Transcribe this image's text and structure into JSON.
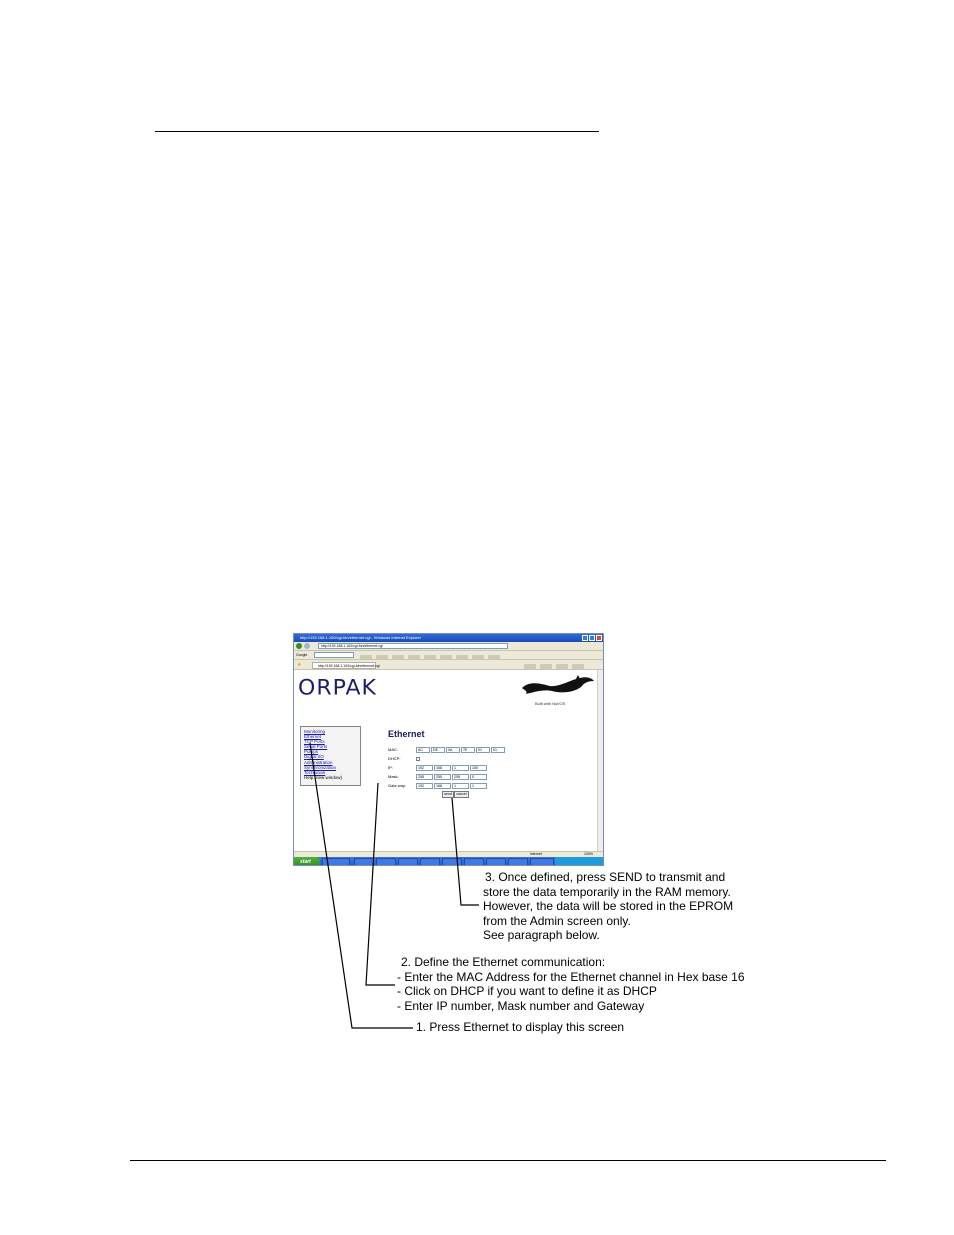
{
  "browser": {
    "title": "http://192.168.1.100/cgi-bin/ethernet.cgi - Windows Internet Explorer",
    "address": "http://192.168.1.100/cgi-bin/ethernet.cgi",
    "google_label": "Google",
    "tab_label": "http://192.168.1.100/cgi-bin/ethernet.cgi",
    "status": "Internet",
    "zoom": "100%",
    "start_label": "start"
  },
  "page": {
    "logo": "ORPAK",
    "built_with": "Built with Nut/OS",
    "heading": "Ethernet",
    "menu": [
      "Monitoring",
      "Ethernet",
      "TCP Ports",
      "Serial Ports",
      "Pumps",
      "Digital I/O",
      "Administration",
      "Synchronization",
      "Technician"
    ],
    "menu_tail": "Help (new window)",
    "form": {
      "mac_label": "MAC:",
      "mac": [
        "AC",
        "DE",
        "0A",
        "7E",
        "01",
        "01"
      ],
      "dhcp_label": "DHCP:",
      "ip_label": "IP:",
      "ip": [
        "192",
        "168",
        "1",
        "100"
      ],
      "mask_label": "Mask:",
      "mask": [
        "255",
        "255",
        "255",
        "0"
      ],
      "gateway_label": "Gate way:",
      "gateway": [
        "192",
        "168",
        "1",
        "1"
      ],
      "send_label": "send",
      "cancel_label": "cancel"
    }
  },
  "annotations": {
    "note3": [
      "3. Once defined, press SEND to transmit and",
      "store  the data temporarily in the RAM memory.",
      "However, the data will be stored in the EPROM",
      "from the Admin screen only.",
      "See paragraph below."
    ],
    "note2": [
      "2. Define the Ethernet communication:",
      "- Enter the MAC Address for the Ethernet channel in Hex base 16",
      "- Click on DHCP if you want to define it as DHCP",
      "- Enter IP number, Mask number and Gateway"
    ],
    "note1": "1. Press Ethernet to display this screen"
  }
}
